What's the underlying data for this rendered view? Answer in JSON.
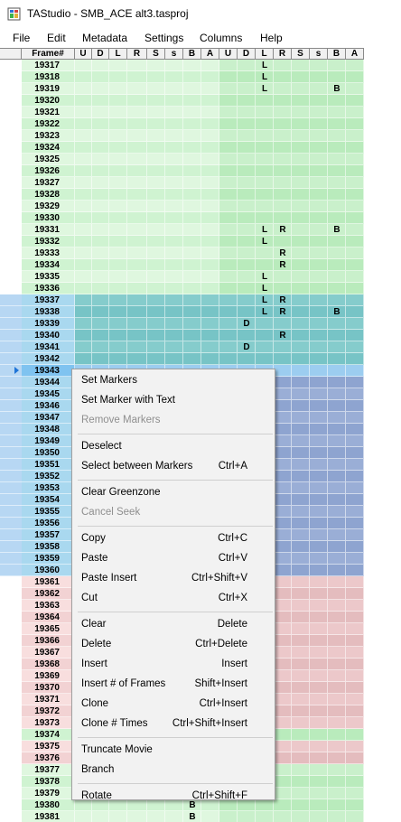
{
  "window": {
    "title": "TAStudio - SMB_ACE alt3.tasproj"
  },
  "menu": [
    "File",
    "Edit",
    "Metadata",
    "Settings",
    "Columns",
    "Help"
  ],
  "grid": {
    "columns": [
      "Frame#",
      "U",
      "D",
      "L",
      "R",
      "S",
      "s",
      "B",
      "A",
      "U",
      "D",
      "L",
      "R",
      "S",
      "s",
      "B",
      "A"
    ],
    "rows": [
      {
        "f": "19317",
        "z": "green",
        "in": {
          "11": "L"
        }
      },
      {
        "f": "19318",
        "z": "green",
        "in": {
          "11": "L"
        }
      },
      {
        "f": "19319",
        "z": "green",
        "in": {
          "11": "L",
          "15": "B"
        }
      },
      {
        "f": "19320",
        "z": "green",
        "in": {}
      },
      {
        "f": "19321",
        "z": "green",
        "in": {}
      },
      {
        "f": "19322",
        "z": "green",
        "in": {}
      },
      {
        "f": "19323",
        "z": "green",
        "in": {}
      },
      {
        "f": "19324",
        "z": "green",
        "in": {}
      },
      {
        "f": "19325",
        "z": "green",
        "in": {}
      },
      {
        "f": "19326",
        "z": "green",
        "in": {}
      },
      {
        "f": "19327",
        "z": "green",
        "in": {}
      },
      {
        "f": "19328",
        "z": "green",
        "in": {}
      },
      {
        "f": "19329",
        "z": "green",
        "in": {}
      },
      {
        "f": "19330",
        "z": "green",
        "in": {}
      },
      {
        "f": "19331",
        "z": "green",
        "in": {
          "11": "L",
          "12": "R",
          "15": "B"
        }
      },
      {
        "f": "19332",
        "z": "green",
        "in": {
          "11": "L"
        }
      },
      {
        "f": "19333",
        "z": "green",
        "in": {
          "12": "R"
        }
      },
      {
        "f": "19334",
        "z": "green",
        "in": {
          "12": "R"
        }
      },
      {
        "f": "19335",
        "z": "green",
        "in": {
          "11": "L"
        }
      },
      {
        "f": "19336",
        "z": "green",
        "in": {
          "11": "L"
        }
      },
      {
        "f": "19337",
        "z": "sel",
        "in": {
          "11": "L",
          "12": "R"
        }
      },
      {
        "f": "19338",
        "z": "sel",
        "in": {
          "11": "L",
          "12": "R",
          "15": "B"
        }
      },
      {
        "f": "19339",
        "z": "sel",
        "in": {
          "10": "D"
        }
      },
      {
        "f": "19340",
        "z": "sel",
        "in": {
          "12": "R"
        }
      },
      {
        "f": "19341",
        "z": "sel",
        "in": {
          "10": "D"
        }
      },
      {
        "f": "19342",
        "z": "sel",
        "in": {}
      },
      {
        "f": "19343",
        "z": "cur",
        "in": {}
      },
      {
        "f": "19344",
        "z": "selb",
        "in": {}
      },
      {
        "f": "19345",
        "z": "selb",
        "in": {}
      },
      {
        "f": "19346",
        "z": "selb",
        "in": {}
      },
      {
        "f": "19347",
        "z": "selb",
        "in": {}
      },
      {
        "f": "19348",
        "z": "selb",
        "in": {}
      },
      {
        "f": "19349",
        "z": "selb",
        "in": {}
      },
      {
        "f": "19350",
        "z": "selb",
        "in": {}
      },
      {
        "f": "19351",
        "z": "selb",
        "in": {}
      },
      {
        "f": "19352",
        "z": "selb",
        "in": {}
      },
      {
        "f": "19353",
        "z": "selb",
        "in": {}
      },
      {
        "f": "19354",
        "z": "selb",
        "in": {}
      },
      {
        "f": "19355",
        "z": "selb",
        "in": {}
      },
      {
        "f": "19356",
        "z": "selb",
        "in": {}
      },
      {
        "f": "19357",
        "z": "selb",
        "in": {}
      },
      {
        "f": "19358",
        "z": "selb",
        "in": {}
      },
      {
        "f": "19359",
        "z": "selb",
        "in": {}
      },
      {
        "f": "19360",
        "z": "selb",
        "in": {}
      },
      {
        "f": "19361",
        "z": "red",
        "in": {}
      },
      {
        "f": "19362",
        "z": "red",
        "in": {}
      },
      {
        "f": "19363",
        "z": "red",
        "in": {}
      },
      {
        "f": "19364",
        "z": "red",
        "in": {}
      },
      {
        "f": "19365",
        "z": "red",
        "in": {}
      },
      {
        "f": "19366",
        "z": "red",
        "in": {}
      },
      {
        "f": "19367",
        "z": "red",
        "in": {}
      },
      {
        "f": "19368",
        "z": "red",
        "in": {}
      },
      {
        "f": "19369",
        "z": "red",
        "in": {}
      },
      {
        "f": "19370",
        "z": "red",
        "in": {}
      },
      {
        "f": "19371",
        "z": "red",
        "in": {}
      },
      {
        "f": "19372",
        "z": "red",
        "in": {}
      },
      {
        "f": "19373",
        "z": "red",
        "in": {}
      },
      {
        "f": "19374",
        "z": "green",
        "in": {}
      },
      {
        "f": "19375",
        "z": "red",
        "in": {}
      },
      {
        "f": "19376",
        "z": "red",
        "in": {}
      },
      {
        "f": "19377",
        "z": "green",
        "in": {}
      },
      {
        "f": "19378",
        "z": "green",
        "in": {}
      },
      {
        "f": "19379",
        "z": "green",
        "in": {}
      },
      {
        "f": "19380",
        "z": "green",
        "in": {
          "7": "B"
        }
      },
      {
        "f": "19381",
        "z": "green",
        "in": {
          "7": "B"
        }
      }
    ]
  },
  "context_menu": [
    {
      "label": "Set Markers",
      "shortcut": "",
      "disabled": false
    },
    {
      "label": "Set Marker with Text",
      "shortcut": "",
      "disabled": false
    },
    {
      "label": "Remove Markers",
      "shortcut": "",
      "disabled": true
    },
    {
      "sep": true
    },
    {
      "label": "Deselect",
      "shortcut": "",
      "disabled": false
    },
    {
      "label": "Select between Markers",
      "shortcut": "Ctrl+A",
      "disabled": false
    },
    {
      "sep": true
    },
    {
      "label": "Clear Greenzone",
      "shortcut": "",
      "disabled": false
    },
    {
      "label": "Cancel Seek",
      "shortcut": "",
      "disabled": true
    },
    {
      "sep": true
    },
    {
      "label": "Copy",
      "shortcut": "Ctrl+C",
      "disabled": false
    },
    {
      "label": "Paste",
      "shortcut": "Ctrl+V",
      "disabled": false
    },
    {
      "label": "Paste Insert",
      "shortcut": "Ctrl+Shift+V",
      "disabled": false
    },
    {
      "label": "Cut",
      "shortcut": "Ctrl+X",
      "disabled": false
    },
    {
      "sep": true
    },
    {
      "label": "Clear",
      "shortcut": "Delete",
      "disabled": false
    },
    {
      "label": "Delete",
      "shortcut": "Ctrl+Delete",
      "disabled": false
    },
    {
      "label": "Insert",
      "shortcut": "Insert",
      "disabled": false
    },
    {
      "label": "Insert # of Frames",
      "shortcut": "Shift+Insert",
      "disabled": false
    },
    {
      "label": "Clone",
      "shortcut": "Ctrl+Insert",
      "disabled": false
    },
    {
      "label": "Clone # Times",
      "shortcut": "Ctrl+Shift+Insert",
      "disabled": false
    },
    {
      "sep": true
    },
    {
      "label": "Truncate Movie",
      "shortcut": "",
      "disabled": false
    },
    {
      "label": "Branch",
      "shortcut": "",
      "disabled": false
    },
    {
      "sep": true
    },
    {
      "label": "Rotate",
      "shortcut": "Ctrl+Shift+F",
      "disabled": false
    }
  ],
  "colors": {
    "green_p1": "#dff7df",
    "green_p2": "#c9f0cb",
    "green_p1_alt": "#cff3d1",
    "green_p2_alt": "#b9ebbc",
    "sel": "#85cccc",
    "sel_alt": "#77c4c6",
    "sel_frame": "#a9d8ef",
    "selb": "#9aaed6",
    "selb_alt": "#8ea4d0",
    "cur": "#9ccdf0",
    "cur_frame": "#7fc3f0",
    "red_p1": "#f8dede",
    "red_p2": "#ecc8ca",
    "red_p1_alt": "#f2d2d3",
    "red_p2_alt": "#e4bcbe",
    "header_bg": "#f0f0f0",
    "menu_bg": "#f2f2f2"
  }
}
